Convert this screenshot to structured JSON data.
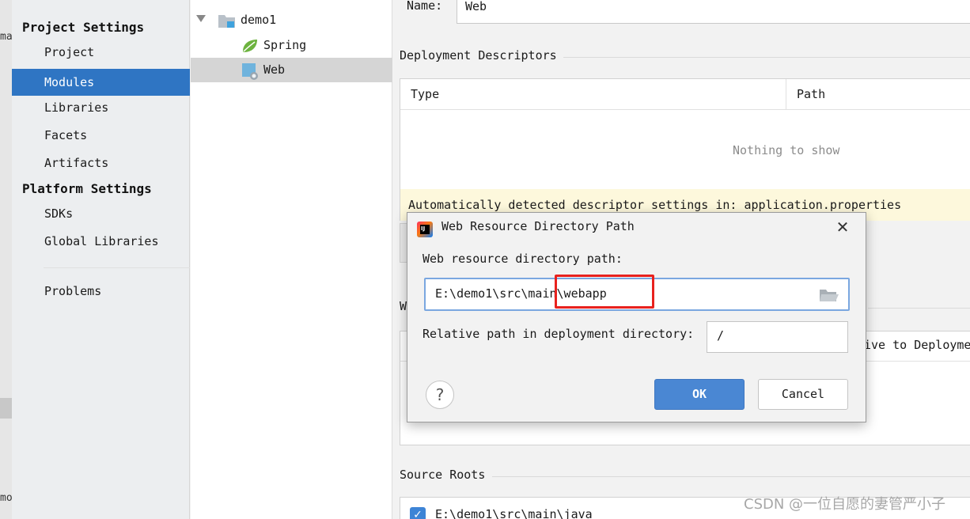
{
  "background_window": {
    "edge_texts": [
      "ma",
      "mo"
    ]
  },
  "nav": {
    "project_settings_header": "Project Settings",
    "project_items": [
      {
        "label": "Project",
        "selected": false
      },
      {
        "label": "Modules",
        "selected": true
      },
      {
        "label": "Libraries",
        "selected": false
      },
      {
        "label": "Facets",
        "selected": false
      },
      {
        "label": "Artifacts",
        "selected": false
      }
    ],
    "platform_settings_header": "Platform Settings",
    "platform_items": [
      {
        "label": "SDKs"
      },
      {
        "label": "Global Libraries"
      }
    ],
    "problems_label": "Problems"
  },
  "tree": {
    "root": {
      "label": "demo1",
      "icon": "module-folder-icon",
      "expanded": true
    },
    "children": [
      {
        "label": "Spring",
        "icon": "spring-leaf-icon",
        "selected": false
      },
      {
        "label": "Web",
        "icon": "web-facet-icon",
        "selected": true
      }
    ]
  },
  "facet": {
    "name_label": "Name:",
    "name_value": "Web",
    "deployment_descriptors_title": "Deployment Descriptors",
    "columns": [
      "Type",
      "Path"
    ],
    "empty_text": "Nothing to show",
    "detect_banner": "Automatically detected descriptor settings in: application.properties",
    "web_resource_section_partial": "W",
    "behind_column_partial": "ive to Deployme",
    "source_roots_title": "Source Roots",
    "source_root_value": "E:\\demo1\\src\\main\\java",
    "source_root_checked": true
  },
  "dialog": {
    "title": "Web Resource Directory Path",
    "directory_label": "Web resource directory path:",
    "directory_value": "E:\\demo1\\src\\main\\webapp",
    "relative_label": "Relative path in deployment directory:",
    "relative_value": "/",
    "ok_label": "OK",
    "cancel_label": "Cancel",
    "help_label": "?",
    "close_label": "✕",
    "logo_letters": "IJ",
    "highlight_color": "#e8221e"
  },
  "colors": {
    "selection_blue": "#2f75c3",
    "ok_button": "#4a87d3",
    "banner_yellow": "#fdf8dc"
  },
  "watermark": "CSDN @一位自愿的妻管严小子"
}
